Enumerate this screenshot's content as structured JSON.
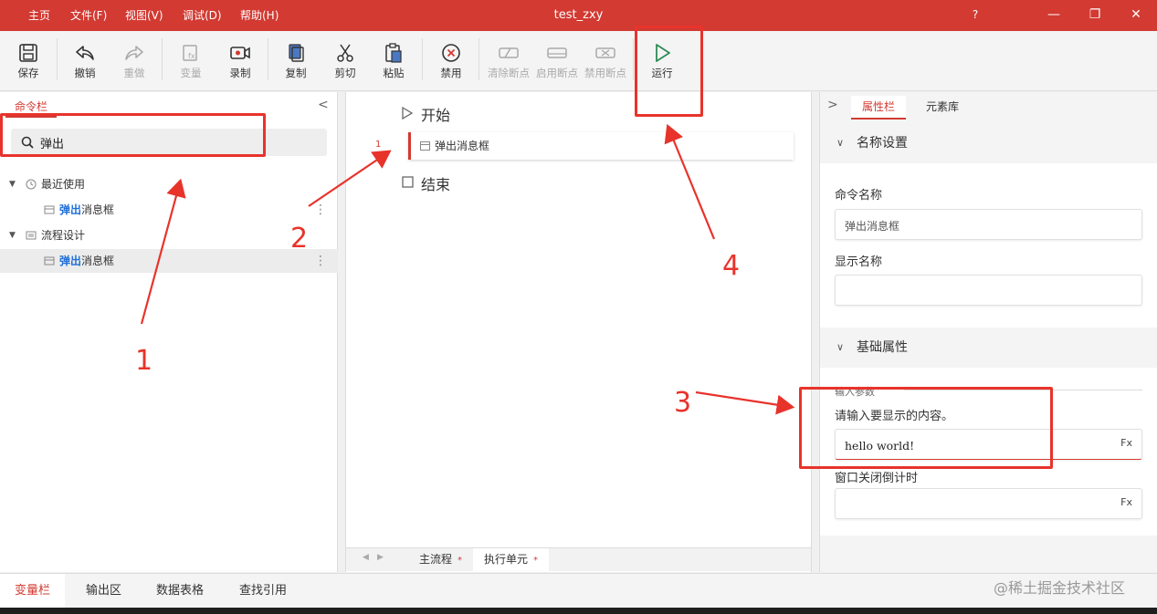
{
  "titlebar": {
    "title": "test_zxy",
    "menus": [
      "主页",
      "文件(F)",
      "视图(V)",
      "调试(D)",
      "帮助(H)"
    ],
    "help": "?",
    "minimize": "—",
    "restore": "❐",
    "close": "✕"
  },
  "toolbar": {
    "save": "保存",
    "undo": "撤销",
    "redo": "重做",
    "variable": "变量",
    "record": "录制",
    "copy": "复制",
    "cut": "剪切",
    "paste": "粘贴",
    "disable": "禁用",
    "clear_bp": "清除断点",
    "enable_bp": "启用断点",
    "disable_bp": "禁用断点",
    "run": "运行"
  },
  "left_panel": {
    "tab": "命令栏",
    "collapse": "<",
    "search_value": "弹出",
    "groups": [
      {
        "name": "最近使用",
        "item_highlight": "弹出",
        "item_rest": "消息框"
      },
      {
        "name": "流程设计",
        "item_highlight": "弹出",
        "item_rest": "消息框"
      }
    ],
    "kebab": "⋮"
  },
  "flow": {
    "start": "开始",
    "line_number": "1",
    "command": "弹出消息框",
    "end": "结束",
    "tabs": [
      {
        "label": "主流程",
        "mark": "*"
      },
      {
        "label": "执行单元",
        "mark": "*"
      }
    ],
    "nav_prev": "◀",
    "nav_next": "▶"
  },
  "right_panel": {
    "expand": ">",
    "tabs": [
      "属性栏",
      "元素库"
    ],
    "section_name": {
      "title": "名称设置",
      "command_name_label": "命令名称",
      "command_name_value": "弹出消息框",
      "display_name_label": "显示名称",
      "display_name_value": ""
    },
    "section_basic": {
      "title": "基础属性",
      "input_params": "输入参数",
      "content_label": "请输入要显示的内容。",
      "content_value": "hello world!",
      "close_countdown_label": "窗口关闭倒计时",
      "close_countdown_value": "",
      "fx": "Fx"
    }
  },
  "bottom_tabs": [
    "变量栏",
    "输出区",
    "数据表格",
    "查找引用"
  ],
  "watermark": "@稀土掘金技术社区",
  "annotations": [
    "1",
    "2",
    "3",
    "4"
  ],
  "colors": {
    "accent": "#d23a32",
    "annotation": "#e8332b",
    "highlight": "#1f6fd8"
  }
}
